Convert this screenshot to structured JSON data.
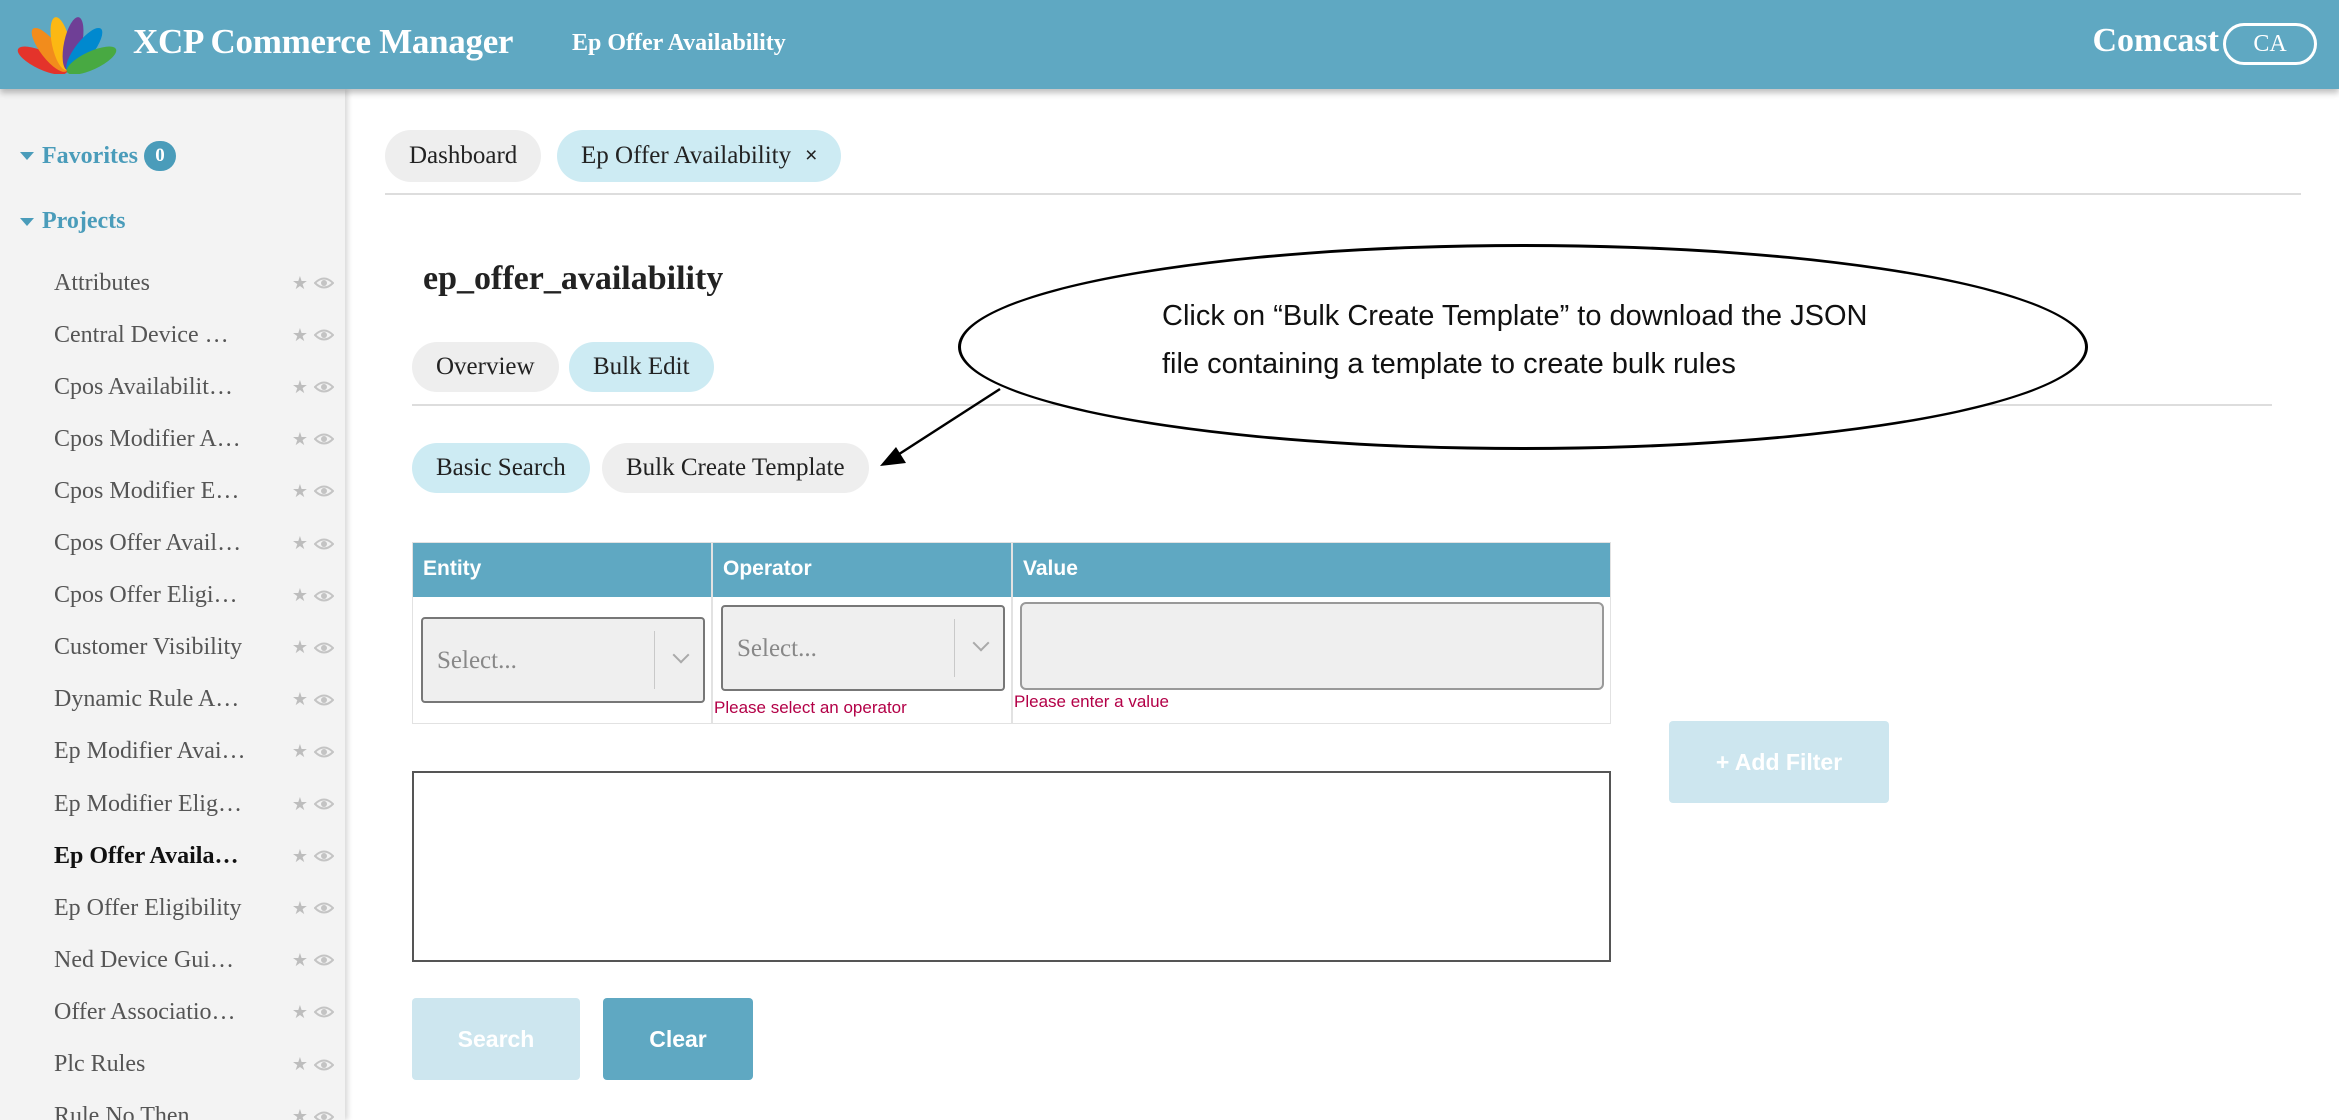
{
  "header": {
    "app_title": "XCP Commerce Manager",
    "page_crumb": "Ep Offer Availability",
    "org_name": "Comcast",
    "org_badge": "CA"
  },
  "sidebar": {
    "favorites_label": "Favorites",
    "favorites_count": "0",
    "projects_label": "Projects",
    "items": [
      {
        "label": "Attributes"
      },
      {
        "label": "Central Device …"
      },
      {
        "label": "Cpos Availabilit…"
      },
      {
        "label": "Cpos Modifier A…"
      },
      {
        "label": "Cpos Modifier E…"
      },
      {
        "label": "Cpos Offer Avail…"
      },
      {
        "label": "Cpos Offer Eligi…"
      },
      {
        "label": "Customer Visibility"
      },
      {
        "label": "Dynamic Rule A…"
      },
      {
        "label": "Ep Modifier Avai…"
      },
      {
        "label": "Ep Modifier Elig…"
      },
      {
        "label": "Ep Offer Availa…",
        "active": true
      },
      {
        "label": "Ep Offer Eligibility"
      },
      {
        "label": "Ned Device Gui…"
      },
      {
        "label": "Offer Associatio…"
      },
      {
        "label": "Plc Rules"
      },
      {
        "label": "Rule No Then"
      }
    ],
    "item_icons": [
      "star-icon",
      "eye-icon"
    ]
  },
  "tabs": {
    "dashboard": "Dashboard",
    "current": "Ep Offer Availability",
    "close_glyph": "×"
  },
  "page": {
    "title": "ep_offer_availability",
    "subtabs": {
      "overview": "Overview",
      "bulk_edit": "Bulk Edit"
    },
    "actions": {
      "basic_search": "Basic Search",
      "bulk_create_template": "Bulk Create Template"
    }
  },
  "filter": {
    "columns": {
      "entity": "Entity",
      "operator": "Operator",
      "value": "Value"
    },
    "entity_placeholder": "Select...",
    "operator_placeholder": "Select...",
    "operator_error": "Please select an operator",
    "value_error": "Please enter a value",
    "add_filter_label": "+ Add Filter"
  },
  "buttons": {
    "search": "Search",
    "clear": "Clear"
  },
  "callout": {
    "line1": "Click on “Bulk Create Template” to download the JSON",
    "line2": "file containing a template to create bulk rules"
  },
  "colors": {
    "brand": "#5fa8c2",
    "active_pill": "#cdebf3",
    "error": "#b30047",
    "disabled_button": "#cde6ef"
  }
}
